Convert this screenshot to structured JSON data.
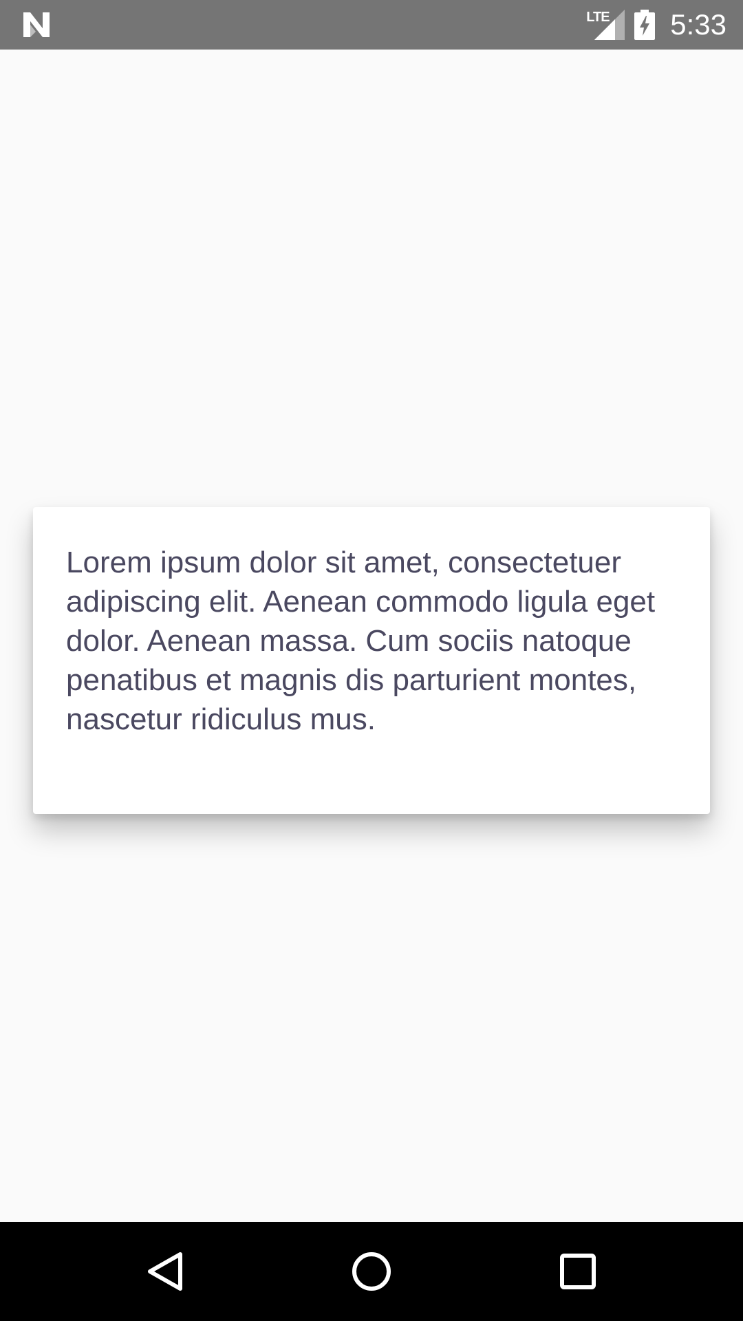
{
  "status_bar": {
    "time": "5:33",
    "network_label": "LTE",
    "notification_icon": "android-n-icon",
    "signal_icon": "signal-icon",
    "battery_icon": "battery-charging-icon",
    "background_color": "#757575"
  },
  "card": {
    "text": "Lorem ipsum dolor sit amet, consectetuer adipiscing elit. Aenean commodo ligula eget dolor. Aenean massa. Cum sociis natoque penatibus et magnis dis parturient montes, nascetur ridiculus mus.",
    "text_color": "#4a4860"
  },
  "nav_bar": {
    "back_icon": "back-triangle-icon",
    "home_icon": "home-circle-icon",
    "recents_icon": "recents-square-icon"
  }
}
